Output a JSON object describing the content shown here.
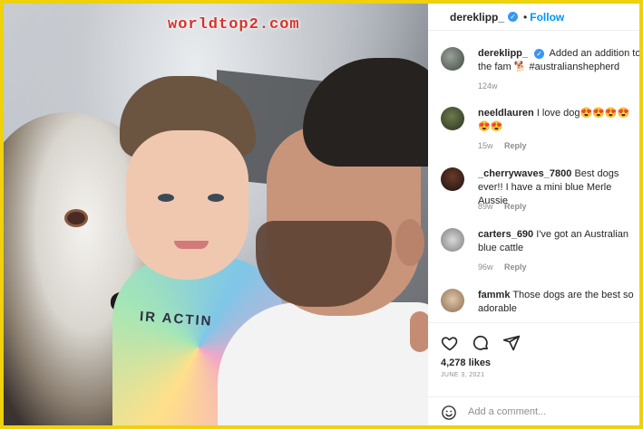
{
  "watermark": "worldtop2.com",
  "photo": {
    "shirt_text": "IR ACTIN"
  },
  "post": {
    "username": "dereklipp_",
    "follow_label": "Follow",
    "caption_user": "dereklipp_",
    "caption_text": "Added an addition to the fam 🐕 #australianshepherd",
    "caption_time": "124w",
    "comments": [
      {
        "user": "neeldlauren",
        "text": "I love dog😍😍😍😍😍😍",
        "time": "15w",
        "reply": "Reply"
      },
      {
        "user": "_cherrywaves_7800",
        "text": "Best dogs ever!! I have a mini blue Merle Aussie",
        "time": "89w",
        "reply": "Reply"
      },
      {
        "user": "carters_690",
        "text": "I've got an Australian blue cattle",
        "time": "96w",
        "reply": "Reply"
      },
      {
        "user": "fammk",
        "text": "Those dogs are the best so adorable"
      }
    ],
    "likes": "4,278 likes",
    "date": "JUNE 3, 2021",
    "comment_placeholder": "Add a comment..."
  },
  "icons": {
    "verified": "verified-badge",
    "like": "heart-icon",
    "comment": "comment-icon",
    "share": "share-icon",
    "emoji": "emoji-icon"
  },
  "colors": {
    "border": "#f0d10d",
    "follow": "#0095f6",
    "watermark": "#d8332a",
    "verified": "#3897f0"
  }
}
